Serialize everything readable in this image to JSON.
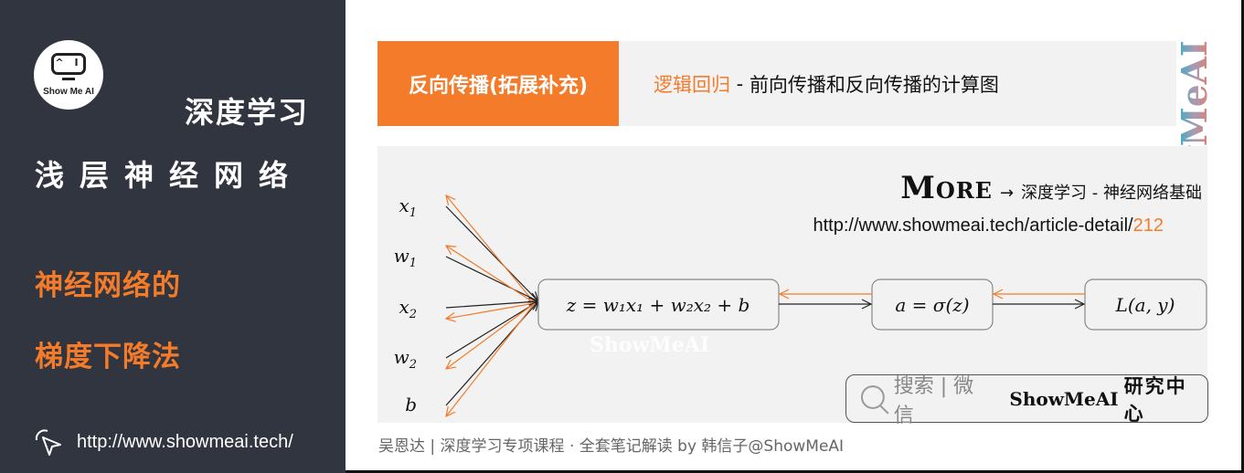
{
  "sidebar": {
    "logo_text": "Show Me AI",
    "logo_face": "^ I",
    "category": "深度学习",
    "topic": "浅层神经网络",
    "subtitle_line1": "神经网络的",
    "subtitle_line2": "梯度下降法",
    "site_url": "http://www.showmeai.tech/"
  },
  "header": {
    "tag": "反向传播(拓展补充)",
    "title_highlight": "逻辑回归",
    "title_sep": " - ",
    "title_rest": "前向传播和反向传播的计算图"
  },
  "watermark": "ShowMeAI",
  "more": {
    "label": "More",
    "arrow": "→",
    "text": "深度学习 - 神经网络基础",
    "url_prefix": "http://www.showmeai.tech/article-detail/",
    "url_id": "212"
  },
  "diagram": {
    "inputs": [
      {
        "base": "x",
        "sub": "1"
      },
      {
        "base": "w",
        "sub": "1"
      },
      {
        "base": "x",
        "sub": "2"
      },
      {
        "base": "w",
        "sub": "2"
      },
      {
        "base": "b",
        "sub": ""
      }
    ],
    "nodes": [
      {
        "id": "linear",
        "label": "z = w₁x₁ + w₂x₂ + b"
      },
      {
        "id": "activation",
        "label": "a = σ(z)"
      },
      {
        "id": "loss",
        "label": "L(a, y)"
      }
    ],
    "forward_color": "#222222",
    "backward_color": "#f47b2a",
    "inline_watermark": "ShowMeAI"
  },
  "search": {
    "placeholder": "搜索 | 微信",
    "brand": "ShowMeAI",
    "brand_suffix": "研究中心"
  },
  "footer": "吴恩达 | 深度学习专项课程 · 全套笔记解读  by 韩信子@ShowMeAI",
  "colors": {
    "accent": "#f47b2a",
    "sidebar_bg": "#30353f",
    "panel_bg": "#f2f2f2"
  }
}
